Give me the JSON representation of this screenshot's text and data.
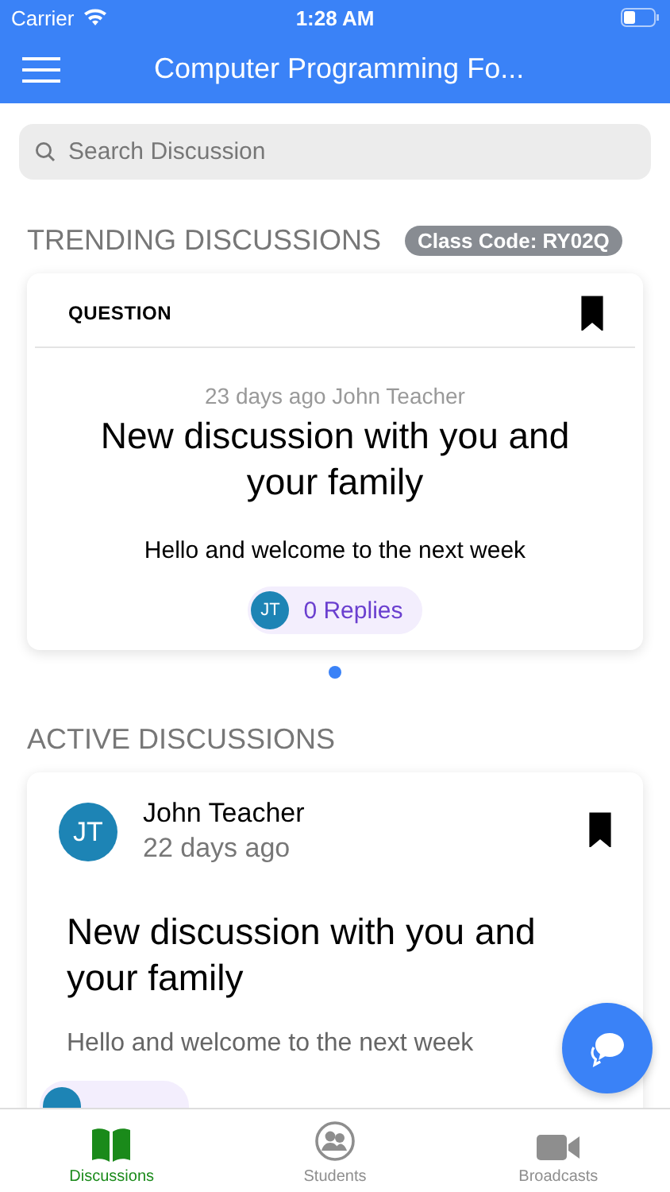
{
  "status_bar": {
    "carrier": "Carrier",
    "time": "1:28 AM"
  },
  "nav": {
    "title": "Computer Programming Fo..."
  },
  "search": {
    "placeholder": "Search Discussion"
  },
  "trending": {
    "heading": "TRENDING DISCUSSIONS",
    "class_code": "Class Code: RY02Q",
    "cards": [
      {
        "type": "QUESTION",
        "bookmarked": true,
        "meta": "23 days ago John Teacher",
        "title": "New discussion with you and your family",
        "body": "Hello and welcome to the next week",
        "initials": "JT",
        "replies": "0 Replies"
      }
    ],
    "pages": [
      {
        "selected": true
      }
    ]
  },
  "active": {
    "heading": "ACTIVE DISCUSSIONS",
    "cards": [
      {
        "author": "John Teacher",
        "initials": "JT",
        "time": "22 days ago",
        "bookmarked": true,
        "title": "New discussion with you and your family",
        "body": "Hello and welcome to the next week"
      }
    ]
  },
  "tabs": [
    {
      "label": "Discussions",
      "kind": "book",
      "selected": true
    },
    {
      "label": "Students",
      "kind": "people",
      "selected": false
    },
    {
      "label": "Broadcasts",
      "kind": "video",
      "selected": false
    }
  ]
}
